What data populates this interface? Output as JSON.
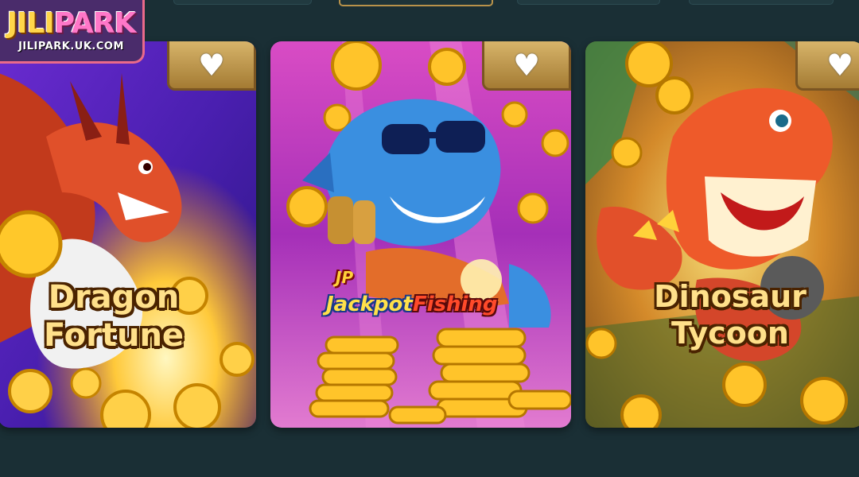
{
  "logo": {
    "part1": "JILI",
    "part2": "PARK",
    "domain": "JILIPARK.UK.COM"
  },
  "games": [
    {
      "title_line1": "Dragon",
      "title_line2": "Fortune",
      "favorite_icon": "heart-icon"
    },
    {
      "badge": "JP",
      "title_part1": "Jackpot",
      "title_part2": "Fishing",
      "favorite_icon": "heart-icon"
    },
    {
      "title_line1": "Dinosaur",
      "title_line2": "Tycoon",
      "favorite_icon": "heart-icon"
    }
  ],
  "colors": {
    "background": "#1a2f35",
    "title_gold": "#ffe08a",
    "accent_pink": "#ff77c8"
  }
}
